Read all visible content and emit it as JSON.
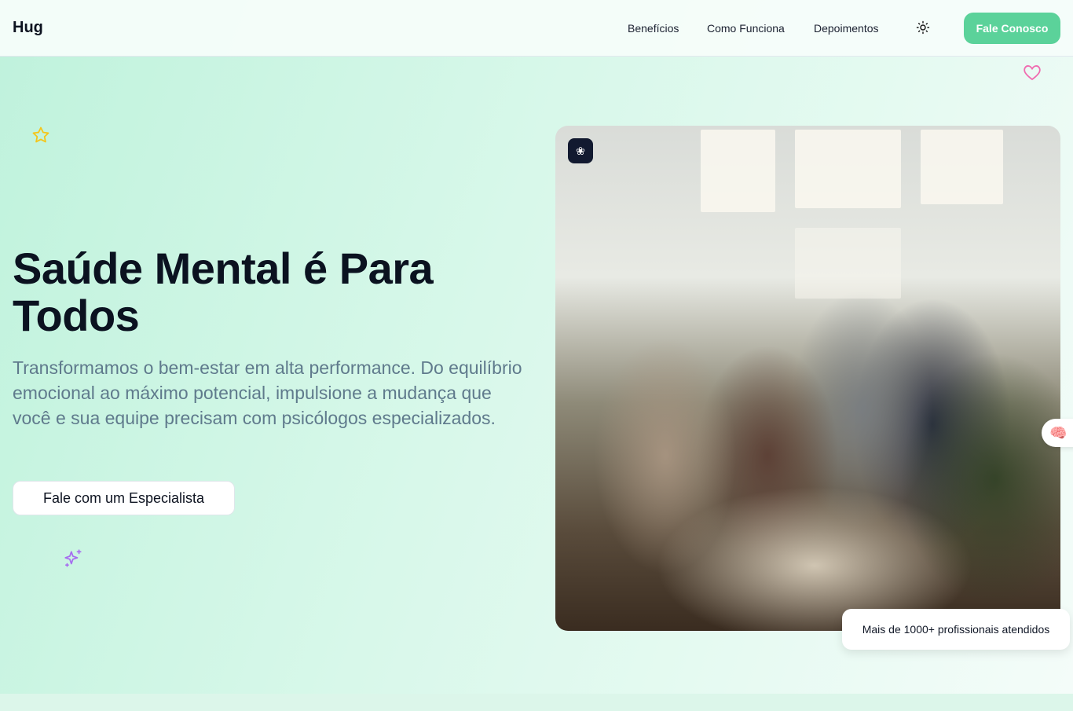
{
  "header": {
    "logo": "Hug",
    "nav": [
      "Benefícios",
      "Como Funciona",
      "Depoimentos"
    ],
    "cta": "Fale Conosco"
  },
  "hero": {
    "title": "Saúde Mental é Para Todos",
    "subtitle": "Transformamos o bem-estar em alta performance. Do equilíbrio emocional ao máximo potencial, impulsione a mudança que você e sua equipe precisam com psicólogos especializados.",
    "button": "Fale com um Especialista",
    "stat": "Mais de 1000+ profissionais atendidos"
  },
  "colors": {
    "accent": "#5bd29a",
    "heart": "#f06bb0",
    "star": "#f5c518",
    "sparkle": "#a66cf0"
  }
}
